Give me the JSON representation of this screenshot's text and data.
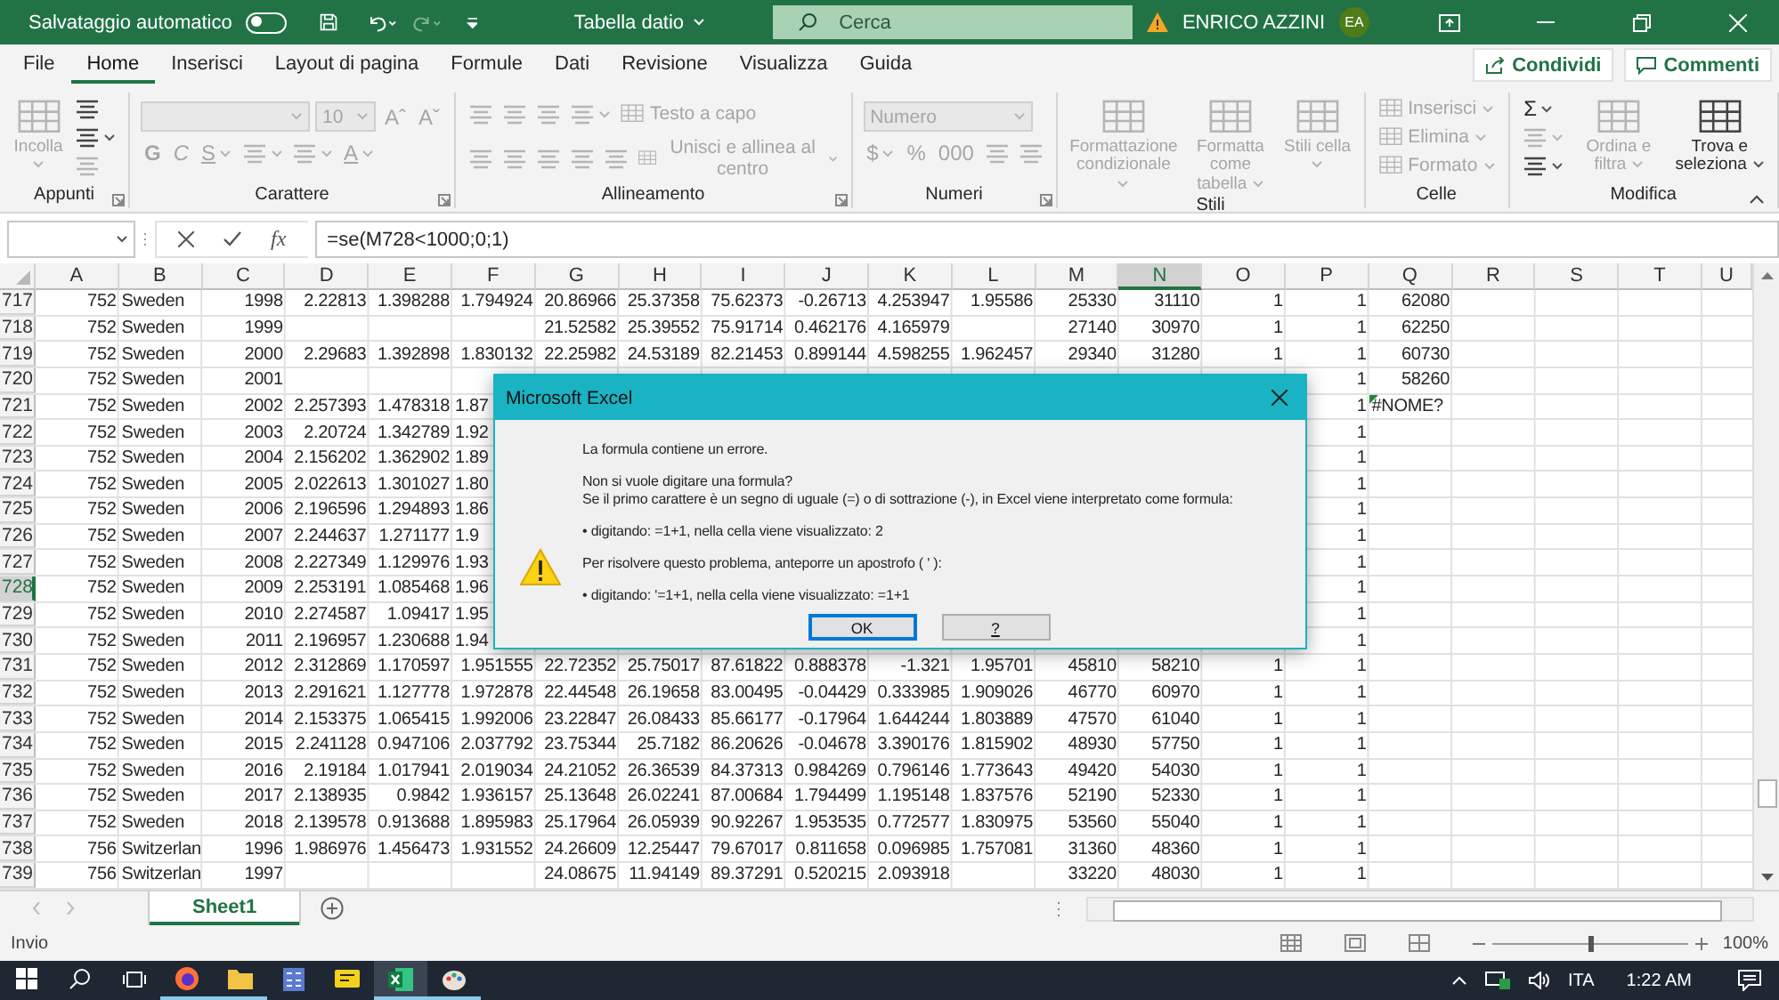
{
  "title_bar": {
    "autosave": {
      "label": "Salvataggio automatico",
      "on": false
    },
    "document": "Tabella datio",
    "search": {
      "placeholder": "Cerca"
    },
    "user": "ENRICO AZZINI",
    "avatar": "EA"
  },
  "menu_tabs": [
    {
      "label": "File",
      "selected": false
    },
    {
      "label": "Home",
      "selected": true
    },
    {
      "label": "Inserisci",
      "selected": false
    },
    {
      "label": "Layout di pagina",
      "selected": false
    },
    {
      "label": "Formule",
      "selected": false
    },
    {
      "label": "Dati",
      "selected": false
    },
    {
      "label": "Revisione",
      "selected": false
    },
    {
      "label": "Visualizza",
      "selected": false
    },
    {
      "label": "Guida",
      "selected": false
    }
  ],
  "share_buttons": [
    "Condividi",
    "Commenti"
  ],
  "ribbon": {
    "groups": [
      {
        "label": "Appunti",
        "launcher": true,
        "kind": "columns",
        "lines": [
          [
            {
              "kind": "large",
              "label": "Incolla",
              "menu": true,
              "disabled": true
            }
          ],
          [
            {
              "kind": "icon",
              "menu": false,
              "disabled": false
            },
            {
              "kind": "icon",
              "menu": true,
              "disabled": false
            },
            {
              "kind": "icon",
              "menu": false,
              "disabled": true
            }
          ]
        ]
      },
      {
        "label": "Carattere",
        "launcher": true,
        "kind": "rows",
        "lines": [
          [
            {
              "kind": "wide-field",
              "menu": true,
              "disabled": true
            },
            {
              "kind": "narrow-field",
              "value": "10",
              "menu": true,
              "disabled": true
            },
            {
              "kind": "text",
              "label": "Aˆ",
              "menu": false,
              "disabled": true
            },
            {
              "kind": "text",
              "label": "Aˇ",
              "menu": false,
              "disabled": true
            }
          ],
          [
            {
              "kind": "bold-text",
              "label": "G",
              "menu": false,
              "disabled": true
            },
            {
              "kind": "italic-text",
              "label": "C",
              "menu": false,
              "disabled": true
            },
            {
              "kind": "underline-text",
              "label": "S",
              "menu": true,
              "disabled": true
            },
            {
              "kind": "icon",
              "menu": true,
              "disabled": true
            },
            {
              "kind": "icon",
              "menu": true,
              "disabled": true
            },
            {
              "kind": "underline-text",
              "label": "A",
              "menu": true,
              "disabled": true
            }
          ]
        ]
      },
      {
        "label": "Allineamento",
        "launcher": true,
        "kind": "rows",
        "lines": [
          [
            {
              "kind": "icon",
              "menu": false,
              "disabled": true
            },
            {
              "kind": "icon",
              "menu": false,
              "disabled": true
            },
            {
              "kind": "icon",
              "menu": false,
              "disabled": true
            },
            {
              "kind": "icon",
              "menu": true,
              "disabled": true
            },
            {
              "kind": "small",
              "label": "Testo a capo",
              "menu": false,
              "disabled": true
            }
          ],
          [
            {
              "kind": "icon",
              "menu": false,
              "disabled": true
            },
            {
              "kind": "icon",
              "menu": false,
              "disabled": true
            },
            {
              "kind": "icon",
              "menu": false,
              "disabled": true
            },
            {
              "kind": "icon",
              "menu": false,
              "disabled": true
            },
            {
              "kind": "icon",
              "menu": false,
              "disabled": true
            },
            {
              "kind": "small",
              "label": "Unisci e allinea al centro",
              "menu": true,
              "disabled": true
            }
          ]
        ]
      },
      {
        "label": "Numeri",
        "launcher": true,
        "kind": "rows",
        "lines": [
          [
            {
              "kind": "wide-field",
              "placeholder": "Numero",
              "menu": true,
              "disabled": true
            }
          ],
          [
            {
              "kind": "text",
              "label": "$",
              "menu": true,
              "disabled": true
            },
            {
              "kind": "text",
              "label": "%",
              "menu": false,
              "disabled": true
            },
            {
              "kind": "text",
              "label": "000",
              "menu": false,
              "disabled": true
            },
            {
              "kind": "icon",
              "menu": false,
              "disabled": true
            },
            {
              "kind": "icon",
              "menu": false,
              "disabled": true
            }
          ]
        ]
      },
      {
        "label": "Stili",
        "launcher": false,
        "kind": "columns",
        "lines": [
          [
            {
              "kind": "large",
              "label": "Formattazione condizionale",
              "menu": true,
              "disabled": true
            }
          ],
          [
            {
              "kind": "large",
              "label": "Formatta come tabella",
              "menu": true,
              "disabled": true
            }
          ],
          [
            {
              "kind": "large",
              "label": "Stili cella",
              "menu": true,
              "disabled": true
            }
          ]
        ]
      },
      {
        "label": "Celle",
        "launcher": false,
        "kind": "columns",
        "lines": [
          [
            {
              "kind": "small",
              "label": "Inserisci",
              "menu": true,
              "disabled": true
            },
            {
              "kind": "small",
              "label": "Elimina",
              "menu": true,
              "disabled": true
            },
            {
              "kind": "small",
              "label": "Formato",
              "menu": true,
              "disabled": true
            }
          ]
        ]
      },
      {
        "label": "Modifica",
        "launcher": false,
        "kind": "columns",
        "lines": [
          [
            {
              "kind": "text",
              "label": "Σ",
              "menu": true,
              "disabled": false
            },
            {
              "kind": "icon",
              "menu": true,
              "disabled": true
            },
            {
              "kind": "icon",
              "menu": true,
              "disabled": false
            }
          ],
          [
            {
              "kind": "large",
              "label": "Ordina e filtra",
              "menu": true,
              "disabled": true
            }
          ],
          [
            {
              "kind": "large",
              "label": "Trova e seleziona",
              "menu": true,
              "disabled": false
            }
          ]
        ]
      }
    ]
  },
  "formula_bar": {
    "function_label": "fx",
    "formula": "=se(M728<1000;0;1)"
  },
  "sheet": {
    "columns": [
      {
        "label": "A",
        "kind": "number",
        "selected": false
      },
      {
        "label": "B",
        "kind": "text",
        "selected": false
      },
      {
        "label": "C",
        "kind": "number",
        "selected": false
      },
      {
        "label": "D",
        "kind": "number",
        "selected": false
      },
      {
        "label": "E",
        "kind": "number",
        "selected": false
      },
      {
        "label": "F",
        "kind": "number",
        "selected": false
      },
      {
        "label": "G",
        "kind": "number",
        "selected": false
      },
      {
        "label": "H",
        "kind": "number",
        "selected": false
      },
      {
        "label": "I",
        "kind": "number",
        "selected": false
      },
      {
        "label": "J",
        "kind": "number",
        "selected": false
      },
      {
        "label": "K",
        "kind": "number",
        "selected": false
      },
      {
        "label": "L",
        "kind": "number",
        "selected": false
      },
      {
        "label": "M",
        "kind": "number",
        "selected": false
      },
      {
        "label": "N",
        "kind": "number",
        "selected": true
      },
      {
        "label": "O",
        "kind": "number",
        "selected": false
      },
      {
        "label": "P",
        "kind": "number",
        "selected": false
      },
      {
        "label": "Q",
        "kind": "number",
        "selected": false
      },
      {
        "label": "R",
        "selected": false
      },
      {
        "label": "S",
        "selected": false
      },
      {
        "label": "T",
        "selected": false
      },
      {
        "label": "U",
        "selected": false
      }
    ],
    "rows": [
      {
        "label": "717",
        "selected": false,
        "cells": [
          "752",
          "Sweden",
          "1998",
          "2.22813",
          "1.398288",
          "1.794924",
          "20.86966",
          "25.37358",
          "75.62373",
          "-0.26713",
          "4.253947",
          "1.95586",
          "25330",
          "31110",
          "1",
          "1",
          "62080"
        ]
      },
      {
        "label": "718",
        "selected": false,
        "cells": [
          "752",
          "Sweden",
          "1999",
          null,
          null,
          null,
          "21.52582",
          "25.39552",
          "75.91714",
          "0.462176",
          "4.165979",
          null,
          "27140",
          "30970",
          "1",
          "1",
          "62250"
        ]
      },
      {
        "label": "719",
        "selected": false,
        "cells": [
          "752",
          "Sweden",
          "2000",
          "2.29683",
          "1.392898",
          "1.830132",
          "22.25982",
          "24.53189",
          "82.21453",
          "0.899144",
          "4.598255",
          "1.962457",
          "29340",
          "31280",
          "1",
          "1",
          "60730"
        ]
      },
      {
        "label": "720",
        "selected": false,
        "cells": [
          "752",
          "Sweden",
          "2001",
          null,
          null,
          null,
          null,
          null,
          null,
          null,
          null,
          null,
          null,
          null,
          null,
          "1",
          "58260"
        ]
      },
      {
        "label": "721",
        "selected": false,
        "cells": [
          "752",
          "Sweden",
          "2002",
          "2.257393",
          "1.478318",
          {
            "text": "1.87",
            "clipped": true
          },
          null,
          null,
          null,
          null,
          null,
          null,
          null,
          null,
          null,
          "1",
          {
            "text": "#NOME?",
            "error": true
          }
        ]
      },
      {
        "label": "722",
        "selected": false,
        "cells": [
          "752",
          "Sweden",
          "2003",
          "2.20724",
          "1.342789",
          {
            "text": "1.92",
            "clipped": true
          },
          null,
          null,
          null,
          null,
          null,
          null,
          null,
          null,
          null,
          "1"
        ]
      },
      {
        "label": "723",
        "selected": false,
        "cells": [
          "752",
          "Sweden",
          "2004",
          "2.156202",
          "1.362902",
          {
            "text": "1.89",
            "clipped": true
          },
          null,
          null,
          null,
          null,
          null,
          null,
          null,
          null,
          null,
          "1"
        ]
      },
      {
        "label": "724",
        "selected": false,
        "cells": [
          "752",
          "Sweden",
          "2005",
          "2.022613",
          "1.301027",
          {
            "text": "1.80",
            "clipped": true
          },
          null,
          null,
          null,
          null,
          null,
          null,
          null,
          null,
          null,
          "1"
        ]
      },
      {
        "label": "725",
        "selected": false,
        "cells": [
          "752",
          "Sweden",
          "2006",
          "2.196596",
          "1.294893",
          {
            "text": "1.86",
            "clipped": true
          },
          null,
          null,
          null,
          null,
          null,
          null,
          null,
          null,
          null,
          "1"
        ]
      },
      {
        "label": "726",
        "selected": false,
        "cells": [
          "752",
          "Sweden",
          "2007",
          "2.244637",
          "1.271177",
          {
            "text": "1.9",
            "clipped": true
          },
          null,
          null,
          null,
          null,
          null,
          null,
          null,
          null,
          null,
          "1"
        ]
      },
      {
        "label": "727",
        "selected": false,
        "cells": [
          "752",
          "Sweden",
          "2008",
          "2.227349",
          "1.129976",
          {
            "text": "1.93",
            "clipped": true
          },
          null,
          null,
          null,
          null,
          null,
          null,
          null,
          null,
          null,
          "1"
        ]
      },
      {
        "label": "728",
        "selected": true,
        "cells": [
          "752",
          "Sweden",
          "2009",
          "2.253191",
          "1.085468",
          {
            "text": "1.96",
            "clipped": true
          },
          null,
          null,
          null,
          null,
          null,
          null,
          null,
          null,
          null,
          "1"
        ]
      },
      {
        "label": "729",
        "selected": false,
        "cells": [
          "752",
          "Sweden",
          "2010",
          "2.274587",
          "1.09417",
          {
            "text": "1.95",
            "clipped": true
          },
          null,
          null,
          null,
          null,
          null,
          null,
          null,
          null,
          null,
          "1"
        ]
      },
      {
        "label": "730",
        "selected": false,
        "cells": [
          "752",
          "Sweden",
          "2011",
          "2.196957",
          "1.230688",
          {
            "text": "1.94",
            "clipped": true
          },
          null,
          null,
          null,
          null,
          null,
          null,
          null,
          null,
          null,
          "1"
        ]
      },
      {
        "label": "731",
        "selected": false,
        "cells": [
          "752",
          "Sweden",
          "2012",
          "2.312869",
          "1.170597",
          "1.951555",
          "22.72352",
          "25.75017",
          "87.61822",
          "0.888378",
          "-1.321",
          "1.95701",
          "45810",
          "58210",
          "1",
          "1"
        ]
      },
      {
        "label": "732",
        "selected": false,
        "cells": [
          "752",
          "Sweden",
          "2013",
          "2.291621",
          "1.127778",
          "1.972878",
          "22.44548",
          "26.19658",
          "83.00495",
          "-0.04429",
          "0.333985",
          "1.909026",
          "46770",
          "60970",
          "1",
          "1"
        ]
      },
      {
        "label": "733",
        "selected": false,
        "cells": [
          "752",
          "Sweden",
          "2014",
          "2.153375",
          "1.065415",
          "1.992006",
          "23.22847",
          "26.08433",
          "85.66177",
          "-0.17964",
          "1.644244",
          "1.803889",
          "47570",
          "61040",
          "1",
          "1"
        ]
      },
      {
        "label": "734",
        "selected": false,
        "cells": [
          "752",
          "Sweden",
          "2015",
          "2.241128",
          "0.947106",
          "2.037792",
          "23.75344",
          "25.7182",
          "86.20626",
          "-0.04678",
          "3.390176",
          "1.815902",
          "48930",
          "57750",
          "1",
          "1"
        ]
      },
      {
        "label": "735",
        "selected": false,
        "cells": [
          "752",
          "Sweden",
          "2016",
          "2.19184",
          "1.017941",
          "2.019034",
          "24.21052",
          "26.36539",
          "84.37313",
          "0.984269",
          "0.796146",
          "1.773643",
          "49420",
          "54030",
          "1",
          "1"
        ]
      },
      {
        "label": "736",
        "selected": false,
        "cells": [
          "752",
          "Sweden",
          "2017",
          "2.138935",
          "0.9842",
          "1.936157",
          "25.13648",
          "26.02241",
          "87.00684",
          "1.794499",
          "1.195148",
          "1.837576",
          "52190",
          "52330",
          "1",
          "1"
        ]
      },
      {
        "label": "737",
        "selected": false,
        "cells": [
          "752",
          "Sweden",
          "2018",
          "2.139578",
          "0.913688",
          "1.895983",
          "25.17964",
          "26.05939",
          "90.92267",
          "1.953535",
          "0.772577",
          "1.830975",
          "53560",
          "55040",
          "1",
          "1"
        ]
      },
      {
        "label": "738",
        "selected": false,
        "cells": [
          "756",
          "Switzerlan",
          "1996",
          "1.986976",
          "1.456473",
          "1.931552",
          "24.26609",
          "12.25447",
          "79.67017",
          "0.811658",
          "0.096985",
          "1.757081",
          "31360",
          "48360",
          "1",
          "1"
        ]
      },
      {
        "label": "739",
        "selected": false,
        "cells": [
          "756",
          "Switzerlan",
          "1997",
          null,
          null,
          null,
          "24.08675",
          "11.94149",
          "89.37291",
          "0.520215",
          "2.093918",
          null,
          "33220",
          "48030",
          "1",
          "1"
        ]
      }
    ]
  },
  "sheet_tabs": [
    {
      "label": "Sheet1",
      "selected": true
    }
  ],
  "status_bar": {
    "mode": "Invio",
    "zoom": {
      "level": 0.5,
      "reading": "100%"
    }
  },
  "dialog": {
    "title": "Microsoft Excel",
    "paragraphs": [
      [
        "La formula contiene un errore."
      ],
      [
        "Non si vuole digitare una formula?",
        "Se il primo carattere è un segno di uguale (=) o di sottrazione (-), in Excel viene interpretato come formula:"
      ],
      [
        "• digitando: =1+1, nella cella viene visualizzato: 2"
      ],
      [
        "Per risolvere questo problema, anteporre un apostrofo ( ' ):"
      ],
      [
        "• digitando: '=1+1, nella cella viene visualizzato: =1+1"
      ]
    ],
    "buttons": [
      {
        "label": "OK",
        "default": true
      },
      {
        "label": "?",
        "default": false
      }
    ]
  },
  "taskbar": {
    "language": "ITA",
    "time": "1:22 AM"
  }
}
